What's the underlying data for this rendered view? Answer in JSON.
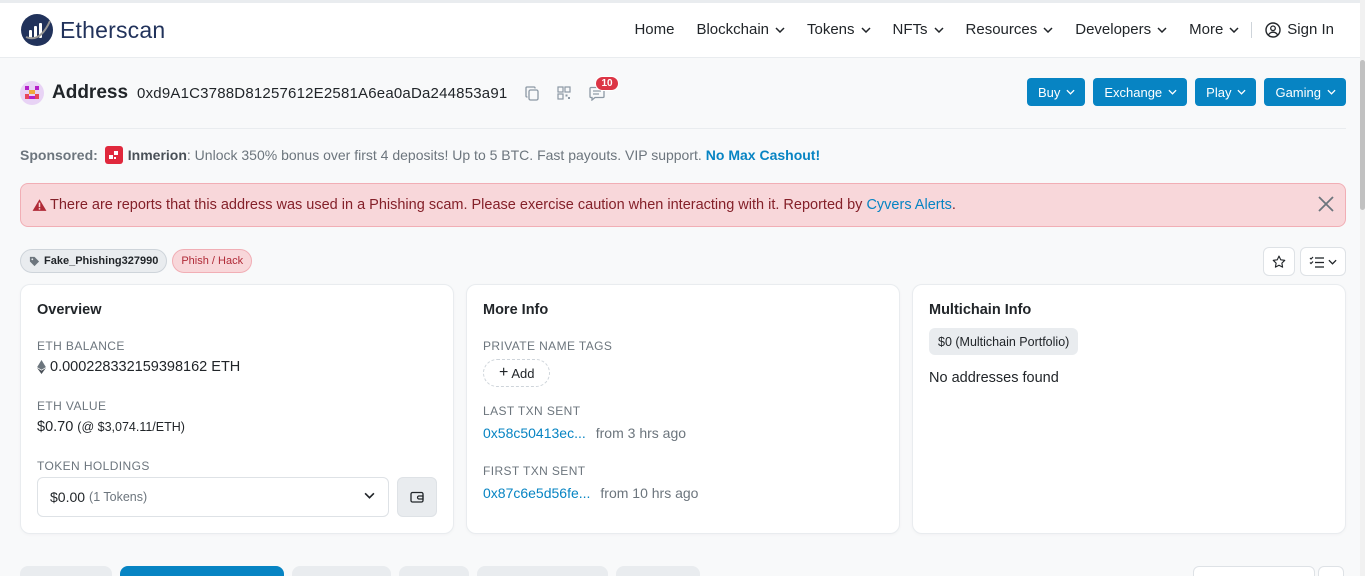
{
  "brand": {
    "name": "Etherscan",
    "logo_icon": "etherscan-logo"
  },
  "nav": {
    "items": [
      {
        "label": "Home",
        "dropdown": false
      },
      {
        "label": "Blockchain",
        "dropdown": true
      },
      {
        "label": "Tokens",
        "dropdown": true
      },
      {
        "label": "NFTs",
        "dropdown": true
      },
      {
        "label": "Resources",
        "dropdown": true
      },
      {
        "label": "Developers",
        "dropdown": true
      },
      {
        "label": "More",
        "dropdown": true
      }
    ],
    "sign_in": "Sign In"
  },
  "address": {
    "label": "Address",
    "hash": "0xd9A1C3788D81257612E2581A6ea0aDa244853a91",
    "comments_count": "10"
  },
  "header_buttons": {
    "buy": "Buy",
    "exchange": "Exchange",
    "play": "Play",
    "gaming": "Gaming"
  },
  "sponsored": {
    "label": "Sponsored:",
    "name": "Inmerion",
    "text": ": Unlock 350% bonus over first 4 deposits! Up to 5 BTC. Fast payouts. VIP support.",
    "link": "No Max Cashout!"
  },
  "alert": {
    "text": "There are reports that this address was used in a Phishing scam. Please exercise caution when interacting with it. Reported by",
    "link": "Cyvers Alerts",
    "suffix": "."
  },
  "tags": {
    "name_tag": "Fake_Phishing327990",
    "label_tag": "Phish / Hack"
  },
  "overview": {
    "title": "Overview",
    "eth_balance_label": "ETH BALANCE",
    "eth_balance": "0.000228332159398162 ETH",
    "eth_value_label": "ETH VALUE",
    "eth_value": "$0.70",
    "eth_price": "(@ $3,074.11/ETH)",
    "token_holdings_label": "TOKEN HOLDINGS",
    "token_value": "$0.00",
    "token_count": "(1 Tokens)"
  },
  "more_info": {
    "title": "More Info",
    "private_tags_label": "PRIVATE NAME TAGS",
    "add_label": "Add",
    "last_txn_label": "LAST TXN SENT",
    "last_txn_hash": "0x58c50413ec...",
    "last_txn_time": "from 3 hrs ago",
    "first_txn_label": "FIRST TXN SENT",
    "first_txn_hash": "0x87c6e5d56fe...",
    "first_txn_time": "from 10 hrs ago"
  },
  "multichain": {
    "title": "Multichain Info",
    "portfolio": "$0 (Multichain Portfolio)",
    "empty": "No addresses found"
  },
  "colors": {
    "accent": "#0784c3",
    "brand": "#21325b",
    "danger": "#dc3545",
    "alert_bg": "#f8d7da"
  }
}
